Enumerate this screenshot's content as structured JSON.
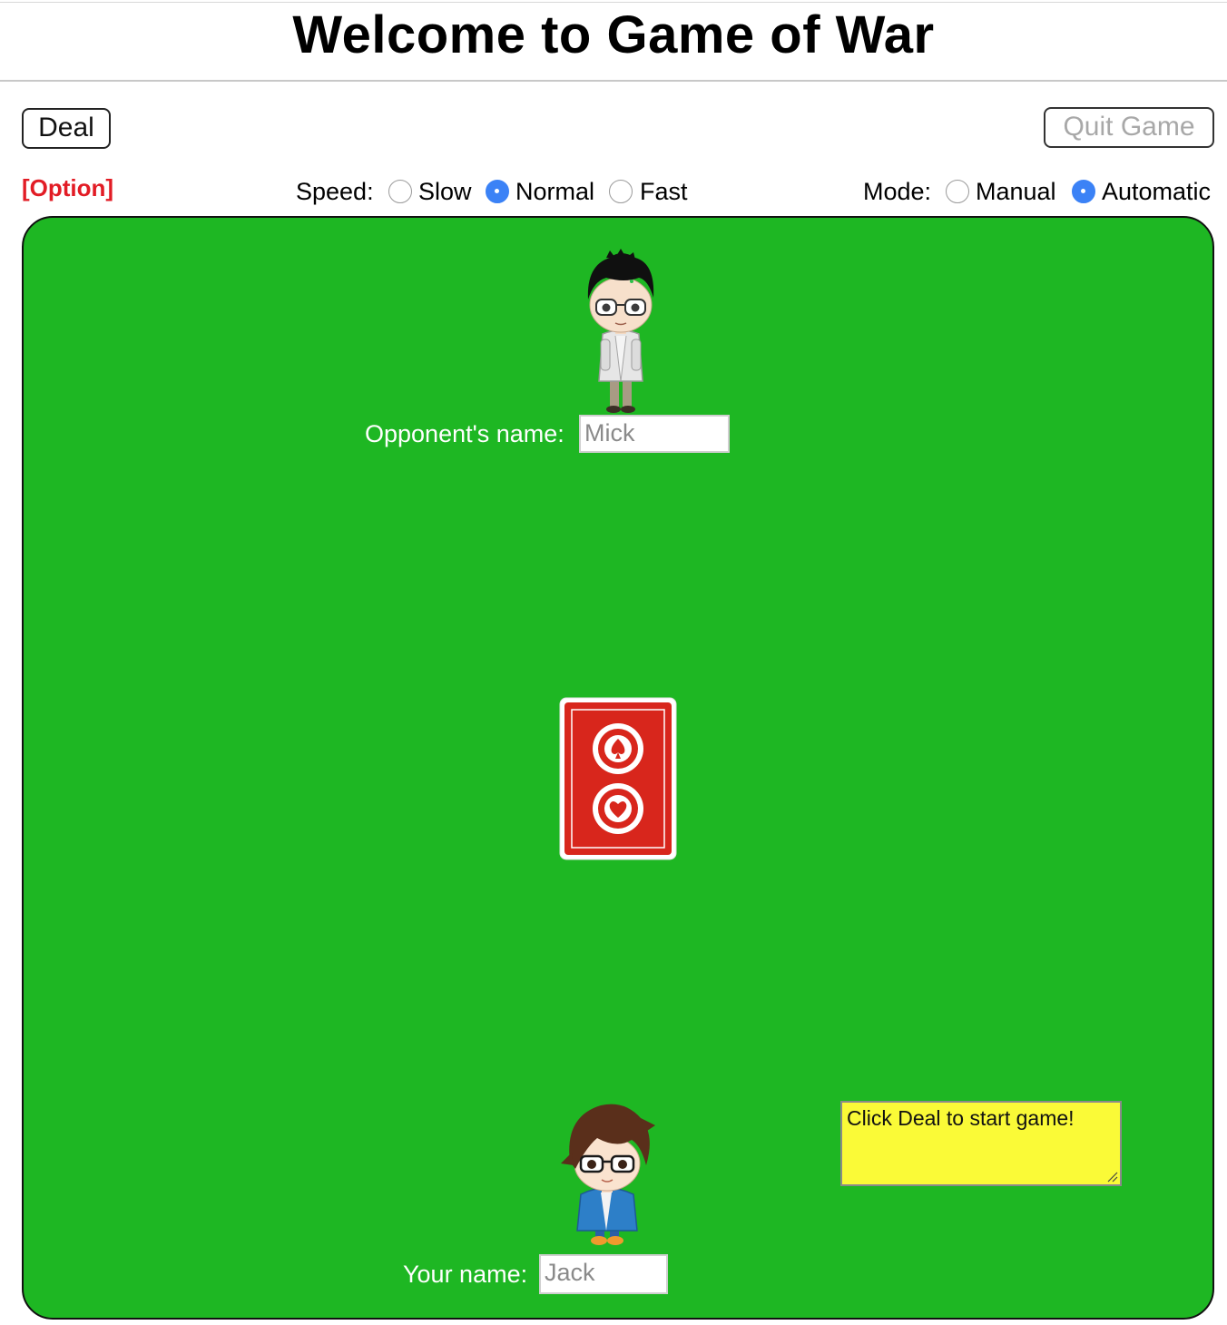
{
  "header": {
    "title": "Welcome to Game of War"
  },
  "toolbar": {
    "deal_label": "Deal",
    "quit_label": "Quit Game",
    "option_label": "[Option]"
  },
  "speed": {
    "label": "Speed:",
    "options": [
      "Slow",
      "Normal",
      "Fast"
    ],
    "selected": "Normal"
  },
  "mode": {
    "label": "Mode:",
    "options": [
      "Manual",
      "Automatic"
    ],
    "selected": "Automatic"
  },
  "table": {
    "color": "#1eb723",
    "opponent": {
      "label": "Opponent's name:",
      "placeholder": "Mick"
    },
    "player": {
      "label": "Your name:",
      "placeholder": "Jack"
    },
    "deck_color": "#d8261c"
  },
  "status": {
    "message": "Click Deal to start game!"
  }
}
